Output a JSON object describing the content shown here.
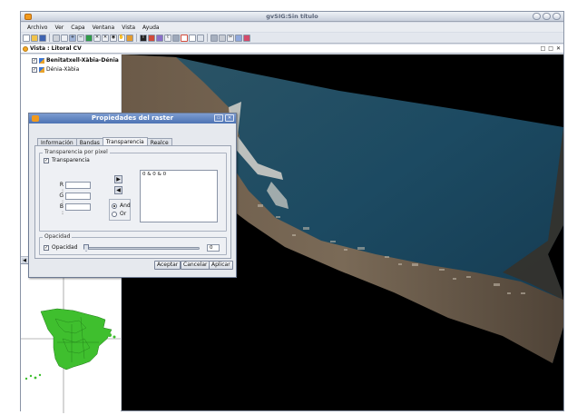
{
  "app": {
    "title": "gvSIG:Sin título"
  },
  "menu": [
    "Archivo",
    "Ver",
    "Capa",
    "Ventana",
    "Vista",
    "Ayuda"
  ],
  "toolbar_icons": [
    "new-icon",
    "open-icon",
    "save-icon",
    "print-icon",
    "copy-icon",
    "zoom-in-icon",
    "zoom-out-icon",
    "zoom-full-icon",
    "pan-icon",
    "info-icon",
    "select-icon",
    "measure-icon",
    "layers-icon",
    "view-icon",
    "table-icon",
    "layout-icon",
    "raster-icon",
    "edit-icon",
    "pdf-icon"
  ],
  "vista": {
    "title": "Vista : Litoral CV",
    "controls": [
      "□",
      "□",
      "✕"
    ]
  },
  "layers": [
    {
      "name": "Benitatxell-Xàbia-Dénia",
      "checked": true,
      "bold": true
    },
    {
      "name": "Dénia-Xàbia",
      "checked": true,
      "bold": false
    }
  ],
  "dialog": {
    "title": "Propiedades del raster",
    "tabs": [
      "Información",
      "Bandas",
      "Transparencia",
      "Realce"
    ],
    "active_tab": "Transparencia",
    "transparency_group": "Transparencia por pixel",
    "transparency_checkbox": "Transparencia",
    "transparency_checked": true,
    "rgb_labels": [
      "R :",
      "G :",
      "B :"
    ],
    "rgb_values": [
      "",
      "",
      ""
    ],
    "radio_options": [
      "And",
      "Or"
    ],
    "radio_selected": "And",
    "values_list": [
      "0 & 0 & 0"
    ],
    "opacity_group": "Opacidad",
    "opacity_checkbox": "Opacidad",
    "opacity_checked": true,
    "opacity_value": "0",
    "buttons": [
      "Aceptar",
      "Cancelar",
      "Aplicar"
    ]
  },
  "colors": {
    "dialog_title": "#4d73b4",
    "land": "#3fbf2e",
    "sea": "#000000"
  }
}
